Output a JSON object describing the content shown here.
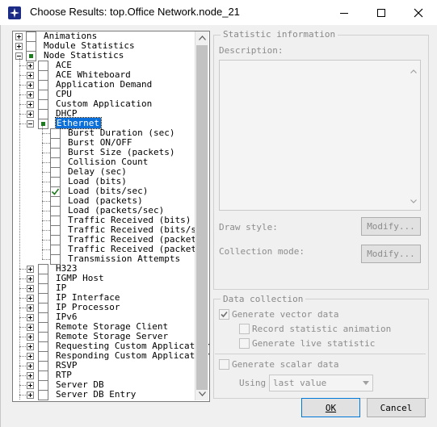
{
  "window": {
    "title": "Choose Results: top.Office Network.node_21",
    "icon": "app-icon",
    "controls": [
      "minimize-icon",
      "maximize-icon",
      "close-icon"
    ]
  },
  "tree": {
    "top_items": [
      {
        "label": "Animations",
        "expanded": false,
        "checked": "none"
      },
      {
        "label": "Module Statistics",
        "expanded": false,
        "checked": "none"
      },
      {
        "label": "Node Statistics",
        "expanded": true,
        "checked": "partial"
      }
    ],
    "node_children": [
      {
        "label": "ACE",
        "checked": "none"
      },
      {
        "label": "ACE Whiteboard",
        "checked": "none"
      },
      {
        "label": "Application Demand",
        "checked": "none"
      },
      {
        "label": "CPU",
        "checked": "none"
      },
      {
        "label": "Custom Application",
        "checked": "none"
      },
      {
        "label": "DHCP",
        "checked": "none"
      },
      {
        "label": "Ethernet",
        "checked": "partial",
        "expanded": true,
        "selected": true
      }
    ],
    "ethernet_children": [
      {
        "label": "Burst Duration (sec)",
        "checked": false
      },
      {
        "label": "Burst ON/OFF",
        "checked": false
      },
      {
        "label": "Burst Size (packets)",
        "checked": false
      },
      {
        "label": "Collision Count",
        "checked": false
      },
      {
        "label": "Delay (sec)",
        "checked": false
      },
      {
        "label": "Load (bits)",
        "checked": false
      },
      {
        "label": "Load (bits/sec)",
        "checked": true
      },
      {
        "label": "Load (packets)",
        "checked": false
      },
      {
        "label": "Load (packets/sec)",
        "checked": false
      },
      {
        "label": "Traffic Received (bits)",
        "checked": false
      },
      {
        "label": "Traffic Received (bits/sec",
        "checked": false
      },
      {
        "label": "Traffic Received (packets)",
        "checked": false
      },
      {
        "label": "Traffic Received (packets/",
        "checked": false
      },
      {
        "label": "Transmission Attempts",
        "checked": false
      }
    ],
    "more_children": [
      {
        "label": "H323"
      },
      {
        "label": "IGMP Host"
      },
      {
        "label": "IP"
      },
      {
        "label": "IP Interface"
      },
      {
        "label": "IP Processor"
      },
      {
        "label": "IPv6"
      },
      {
        "label": "Remote Storage Client"
      },
      {
        "label": "Remote Storage Server"
      },
      {
        "label": "Requesting Custom Application"
      },
      {
        "label": "Responding Custom Application"
      },
      {
        "label": "RSVP"
      },
      {
        "label": "RTP"
      },
      {
        "label": "Server DB"
      },
      {
        "label": "Server DB Entry"
      }
    ]
  },
  "statistic_info": {
    "legend": "Statistic information",
    "description_label": "Description:",
    "description_value": "",
    "draw_style_label": "Draw style:",
    "collection_mode_label": "Collection mode:",
    "modify_label": "Modify..."
  },
  "data_collection": {
    "legend": "Data collection",
    "generate_vector": {
      "label": "Generate vector data",
      "checked": true
    },
    "record_animation": {
      "label": "Record statistic animation",
      "checked": false
    },
    "generate_live": {
      "label": "Generate live statistic",
      "checked": false
    },
    "generate_scalar": {
      "label": "Generate scalar data",
      "checked": false
    },
    "using_label": "Using",
    "using_value": "last value"
  },
  "buttons": {
    "ok": "OK",
    "cancel": "Cancel"
  },
  "colors": {
    "selection": "#0a6fd8",
    "check_green": "#1d7c1d",
    "app_icon": "#1c2c86"
  }
}
